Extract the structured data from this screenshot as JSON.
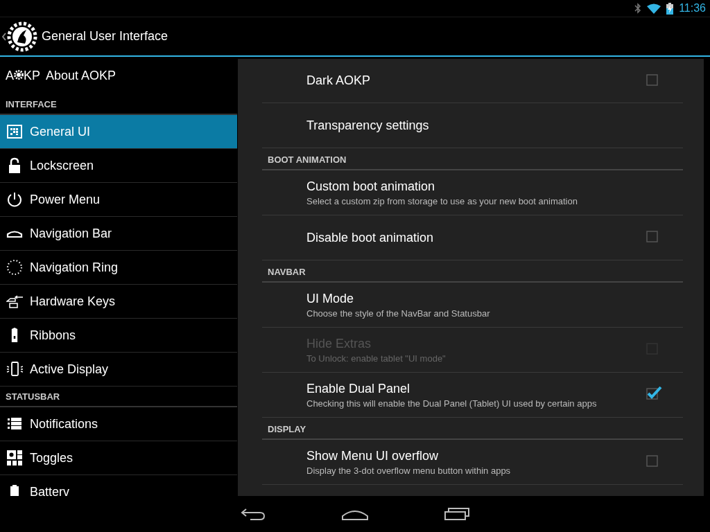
{
  "status_bar": {
    "time": "11:36"
  },
  "action_bar": {
    "title": "General User Interface"
  },
  "sidebar": {
    "about": {
      "logo_left": "A",
      "logo_right": "KP",
      "label": "About AOKP"
    },
    "sections": [
      {
        "title": "INTERFACE",
        "items": [
          {
            "label": "General UI",
            "selected": true
          },
          {
            "label": "Lockscreen",
            "selected": false
          },
          {
            "label": "Power Menu",
            "selected": false
          },
          {
            "label": "Navigation Bar",
            "selected": false
          },
          {
            "label": "Navigation Ring",
            "selected": false
          },
          {
            "label": "Hardware Keys",
            "selected": false
          },
          {
            "label": "Ribbons",
            "selected": false
          },
          {
            "label": "Active Display",
            "selected": false
          }
        ]
      },
      {
        "title": "STATUSBAR",
        "items": [
          {
            "label": "Notifications",
            "selected": false
          },
          {
            "label": "Toggles",
            "selected": false
          },
          {
            "label": "Batterv",
            "selected": false
          }
        ]
      }
    ]
  },
  "preferences": [
    {
      "kind": "checkbox",
      "title": "Dark AOKP",
      "checked": false,
      "disabled": false
    },
    {
      "kind": "link",
      "title": "Transparency settings"
    },
    {
      "kind": "header",
      "title": "BOOT ANIMATION"
    },
    {
      "kind": "link",
      "title": "Custom boot animation",
      "summary": "Select a custom zip from storage to use as your new boot animation"
    },
    {
      "kind": "checkbox",
      "title": "Disable boot animation",
      "checked": false,
      "disabled": false
    },
    {
      "kind": "header",
      "title": "NAVBAR"
    },
    {
      "kind": "link",
      "title": "UI Mode",
      "summary": "Choose the style of the NavBar and Statusbar"
    },
    {
      "kind": "checkbox",
      "title": "Hide Extras",
      "summary": "To Unlock: enable tablet \"UI mode\"",
      "checked": false,
      "disabled": true
    },
    {
      "kind": "checkbox",
      "title": "Enable Dual Panel",
      "summary": "Checking this will enable the Dual Panel (Tablet) UI used by certain apps",
      "checked": true,
      "disabled": false
    },
    {
      "kind": "header",
      "title": "DISPLAY"
    },
    {
      "kind": "checkbox",
      "title": "Show Menu UI overflow",
      "summary": "Display the 3-dot overflow menu button within apps",
      "checked": false,
      "disabled": false
    }
  ]
}
